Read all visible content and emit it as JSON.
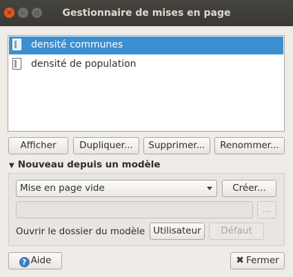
{
  "window": {
    "title": "Gestionnaire de mises en page"
  },
  "layouts": [
    {
      "label": "densité communes",
      "selected": true
    },
    {
      "label": "densité de population",
      "selected": false
    }
  ],
  "actions": {
    "show": "Afficher",
    "duplicate": "Dupliquer...",
    "delete": "Supprimer...",
    "rename": "Renommer..."
  },
  "template_section": {
    "title": "Nouveau depuis un modèle",
    "combo_value": "Mise en page vide",
    "create_label": "Créer...",
    "path_value": "",
    "browse_label": "...",
    "open_folder_label": "Ouvrir le dossier du modèle",
    "user_label": "Utilisateur",
    "default_label": "Défaut"
  },
  "footer": {
    "help_label": "Aide",
    "close_label": "Fermer"
  },
  "colors": {
    "selection": "#3b8fd1",
    "titlebar": "#3c3b37",
    "close_button": "#e95420"
  }
}
